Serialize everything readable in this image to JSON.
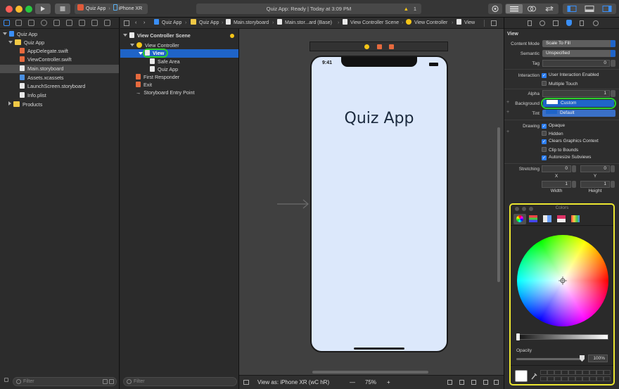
{
  "toolbar": {
    "scheme_app": "Quiz App",
    "scheme_device": "iPhone XR",
    "status": "Quiz App: Ready | Today at 3:09 PM",
    "warning_count": "1"
  },
  "navigator": {
    "project": "Quiz App",
    "group": "Quiz App",
    "files": [
      "AppDelegate.swift",
      "ViewController.swift",
      "Main.storyboard",
      "Assets.xcassets",
      "LaunchScreen.storyboard",
      "Info.plist"
    ],
    "products": "Products",
    "filter_placeholder": "Filter"
  },
  "jumpbar": {
    "items": [
      "Quiz App",
      "Quiz App",
      "Main.storyboard",
      "Main.stor...ard (Base)",
      "View Controller Scene",
      "View Controller",
      "View"
    ]
  },
  "outline": {
    "scene": "View Controller Scene",
    "controller": "View Controller",
    "view": "View",
    "safe_area": "Safe Area",
    "label": "Quiz App",
    "first_responder": "First Responder",
    "exit": "Exit",
    "entry_point": "Storyboard Entry Point",
    "filter_placeholder": "Filter"
  },
  "canvas": {
    "time": "9:41",
    "title_label": "Quiz App",
    "view_as": "View as: iPhone XR (wC hR)",
    "zoom": "75%",
    "zoom_out": "—",
    "zoom_in": "+"
  },
  "inspector": {
    "section": "View",
    "content_mode_label": "Content Mode",
    "content_mode": "Scale To Fill",
    "semantic_label": "Semantic",
    "semantic": "Unspecified",
    "tag_label": "Tag",
    "tag": "0",
    "interaction_label": "Interaction",
    "user_interaction": "User Interaction Enabled",
    "multiple_touch": "Multiple Touch",
    "alpha_label": "Alpha",
    "alpha": "1",
    "background_label": "Background",
    "background": "Custom",
    "tint_label": "Tint",
    "tint": "Default",
    "drawing_label": "Drawing",
    "opaque": "Opaque",
    "hidden": "Hidden",
    "clears_graphics": "Clears Graphics Context",
    "clip_to_bounds": "Clip to Bounds",
    "autoresize": "Autoresize Subviews",
    "stretching_label": "Stretching",
    "stretch_x": "0",
    "stretch_y": "0",
    "stretch_w": "1",
    "stretch_h": "1",
    "x_label": "X",
    "y_label": "Y",
    "width_label": "Width",
    "height_label": "Height",
    "plus": "+"
  },
  "colors_panel": {
    "title": "Colors",
    "opacity_label": "Opacity",
    "opacity": "100%"
  },
  "colors": {
    "highlight_green": "#2bd12e",
    "highlight_yellow": "#ece630",
    "phone_bg": "#dce8fb",
    "selection_blue": "#1f64c8"
  }
}
